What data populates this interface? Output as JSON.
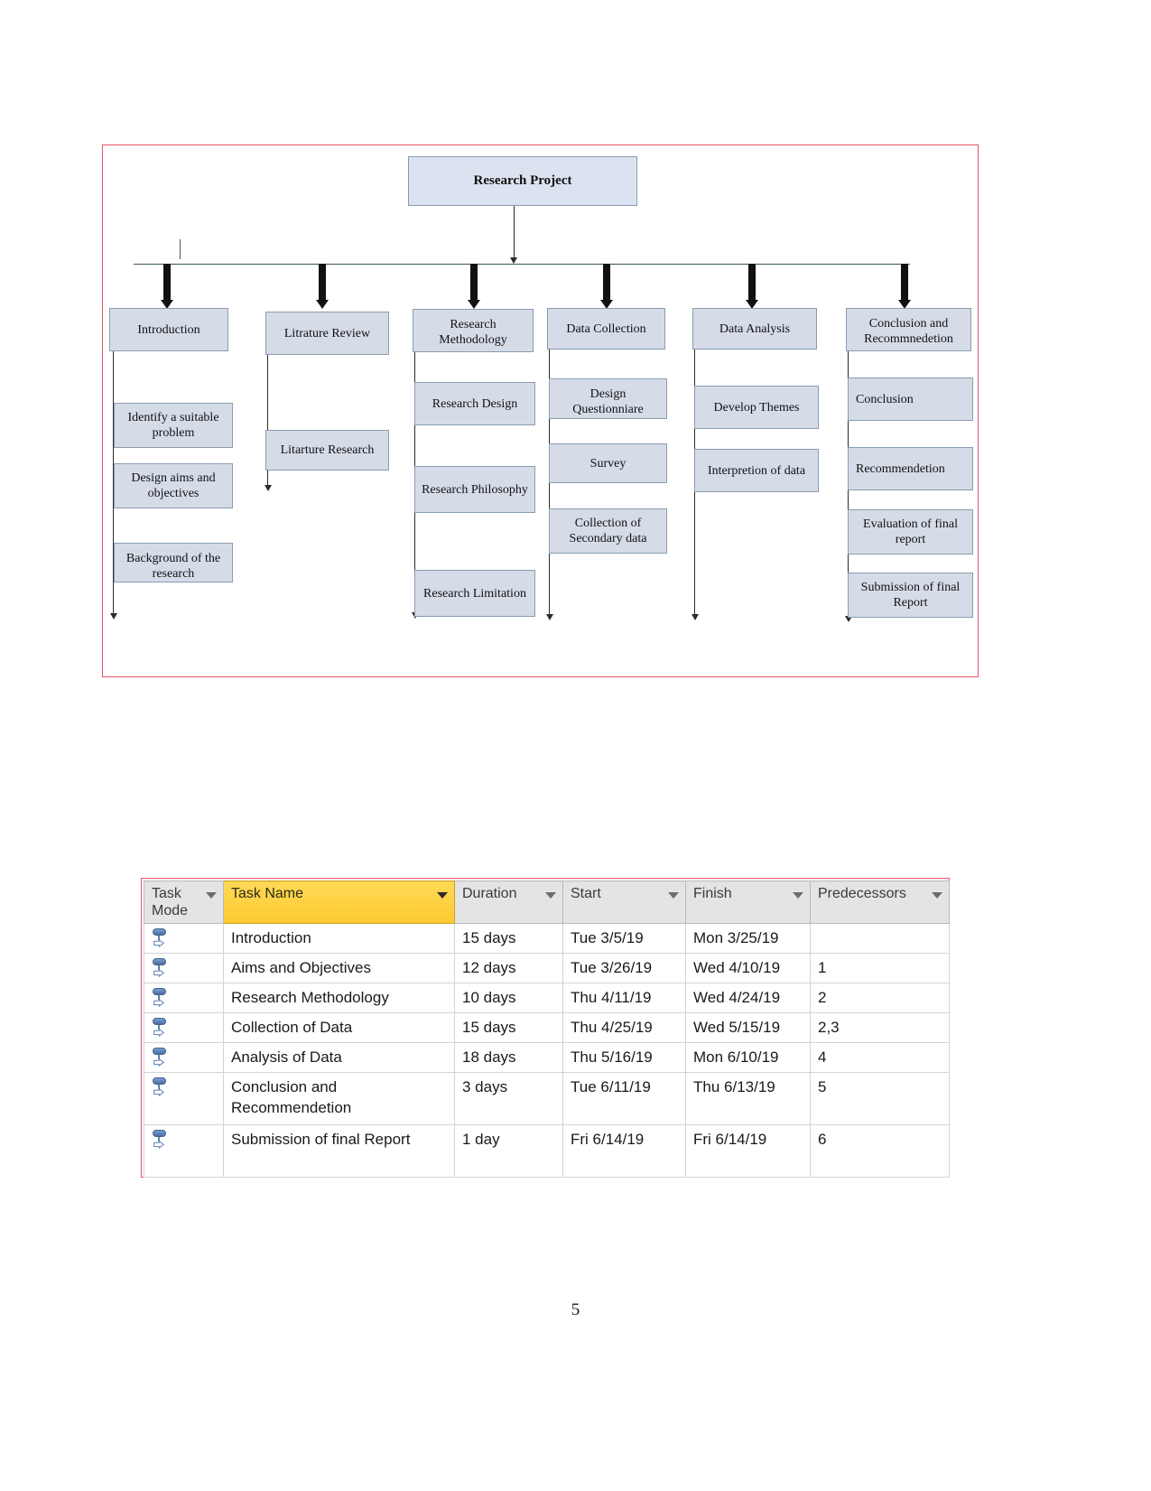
{
  "page": {
    "number": "5"
  },
  "flowchart": {
    "root": {
      "label": "Research Project"
    },
    "branches": [
      {
        "title": "Introduction",
        "children": [
          "Identify a suitable problem",
          "Design aims and objectives",
          "Background of the research"
        ]
      },
      {
        "title": "Litrature Review",
        "children": [
          "Litarture Research"
        ]
      },
      {
        "title": "Research Methodology",
        "children": [
          "Research Design",
          "Research Philosophy",
          "Research Limitation"
        ]
      },
      {
        "title": "Data Collection",
        "children": [
          "Design Questionniare",
          "Survey",
          "Collection of Secondary data"
        ]
      },
      {
        "title": "Data Analysis",
        "children": [
          "Develop Themes",
          "Interpretion of data"
        ]
      },
      {
        "title": "Conclusion and Recommnedetion",
        "children": [
          "Conclusion",
          "Recommendetion",
          "Evaluation of final report",
          "Submission of final Report"
        ]
      }
    ],
    "colors": {
      "node_fill": "#d5dce8",
      "node_border": "#8a9cb0",
      "frame_border": "#e8546a",
      "arrow": "#111111"
    }
  },
  "task_table": {
    "columns": [
      "Task Mode",
      "Task Name",
      "Duration",
      "Start",
      "Finish",
      "Predecessors"
    ],
    "accent_header_color": "#ffd44f",
    "rows": [
      {
        "mode_icon": "manual-schedule-icon",
        "name": "Introduction",
        "duration": "15 days",
        "start": "Tue 3/5/19",
        "finish": "Mon 3/25/19",
        "predecessors": ""
      },
      {
        "mode_icon": "manual-schedule-icon",
        "name": "Aims and Objectives",
        "duration": "12 days",
        "start": "Tue 3/26/19",
        "finish": "Wed 4/10/19",
        "predecessors": "1"
      },
      {
        "mode_icon": "manual-schedule-icon",
        "name": "Research Methodology",
        "duration": "10 days",
        "start": "Thu 4/11/19",
        "finish": "Wed 4/24/19",
        "predecessors": "2"
      },
      {
        "mode_icon": "manual-schedule-icon",
        "name": "Collection of Data",
        "duration": "15 days",
        "start": "Thu 4/25/19",
        "finish": "Wed 5/15/19",
        "predecessors": "2,3"
      },
      {
        "mode_icon": "manual-schedule-icon",
        "name": "Analysis of Data",
        "duration": "18 days",
        "start": "Thu 5/16/19",
        "finish": "Mon 6/10/19",
        "predecessors": "4"
      },
      {
        "mode_icon": "manual-schedule-icon",
        "name": "Conclusion and Recommendetion",
        "duration": "3 days",
        "start": "Tue 6/11/19",
        "finish": "Thu 6/13/19",
        "predecessors": "5"
      },
      {
        "mode_icon": "manual-schedule-icon",
        "name": "Submission of final Report",
        "duration": "1 day",
        "start": "Fri 6/14/19",
        "finish": "Fri 6/14/19",
        "predecessors": "6"
      }
    ]
  }
}
